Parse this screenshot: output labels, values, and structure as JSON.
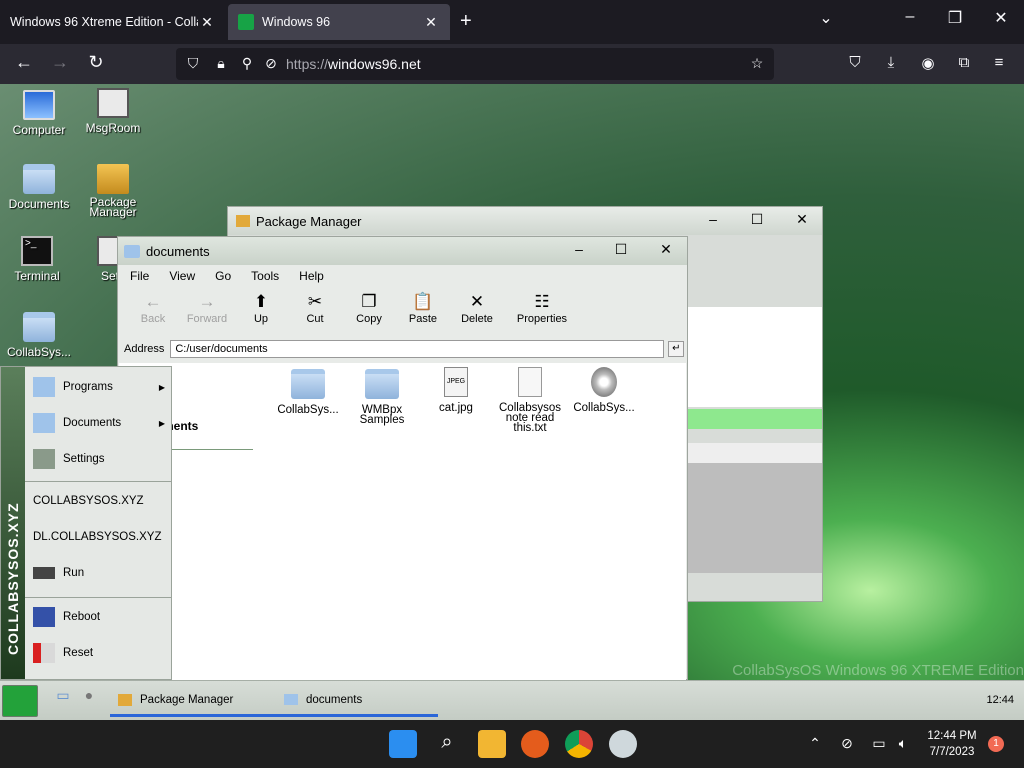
{
  "browser": {
    "tabs": [
      {
        "title": "Windows 96 Xtreme Edition - Colla",
        "close": "✕"
      },
      {
        "title": "Windows 96",
        "close": "✕"
      }
    ],
    "new_tab": "+",
    "url_prefix": "https://",
    "url_host": "windows96.net"
  },
  "desktop": {
    "icons": [
      {
        "label": "Computer"
      },
      {
        "label": "MsgRoom"
      },
      {
        "label": "Documents"
      },
      {
        "label": "Package Manager"
      },
      {
        "label": "Terminal"
      },
      {
        "label": "Setti"
      },
      {
        "label": "CollabSys..."
      }
    ],
    "watermark": "CollabSysOS Windows 96 XTREME Edition"
  },
  "package_manager": {
    "title": "Package Manager"
  },
  "documents_window": {
    "title": "documents",
    "menu": [
      "File",
      "View",
      "Go",
      "Tools",
      "Help"
    ],
    "toolbar": [
      {
        "label": "Back",
        "icon": "←",
        "enabled": false
      },
      {
        "label": "Forward",
        "icon": "→",
        "enabled": false
      },
      {
        "label": "Up",
        "icon": "⬆",
        "enabled": true
      },
      {
        "label": "Cut",
        "icon": "✂",
        "enabled": true
      },
      {
        "label": "Copy",
        "icon": "❐",
        "enabled": true
      },
      {
        "label": "Paste",
        "icon": "📋",
        "enabled": true
      },
      {
        "label": "Delete",
        "icon": "✕",
        "enabled": true
      },
      {
        "label": "Properties",
        "icon": "☷",
        "enabled": true
      }
    ],
    "address_label": "Address",
    "address_value": "C:/user/documents",
    "side_heading": "cuments",
    "files": [
      {
        "name": "CollabSys...",
        "type": "folder"
      },
      {
        "name": "WMBpx Samples",
        "type": "folder"
      },
      {
        "name": "cat.jpg",
        "type": "jpeg"
      },
      {
        "name": "Collabsysos note read this.txt",
        "type": "text"
      },
      {
        "name": "CollabSys...",
        "type": "disc"
      }
    ]
  },
  "start_menu": {
    "band_text": "COLLABSYSOS.XYZ",
    "items": [
      {
        "label": "Programs"
      },
      {
        "label": "Documents"
      },
      {
        "label": "Settings"
      },
      {
        "label": "COLLABSYSOS.XYZ"
      },
      {
        "label": "DL.COLLABSYSOS.XYZ"
      },
      {
        "label": "Run"
      },
      {
        "label": "Reboot"
      },
      {
        "label": "Reset"
      }
    ]
  },
  "w96_taskbar": {
    "tasks": [
      {
        "label": "Package Manager"
      },
      {
        "label": "documents"
      }
    ],
    "clock": "12:44"
  },
  "os_taskbar": {
    "time": "12:44 PM",
    "date": "7/7/2023",
    "notifications": "1"
  }
}
